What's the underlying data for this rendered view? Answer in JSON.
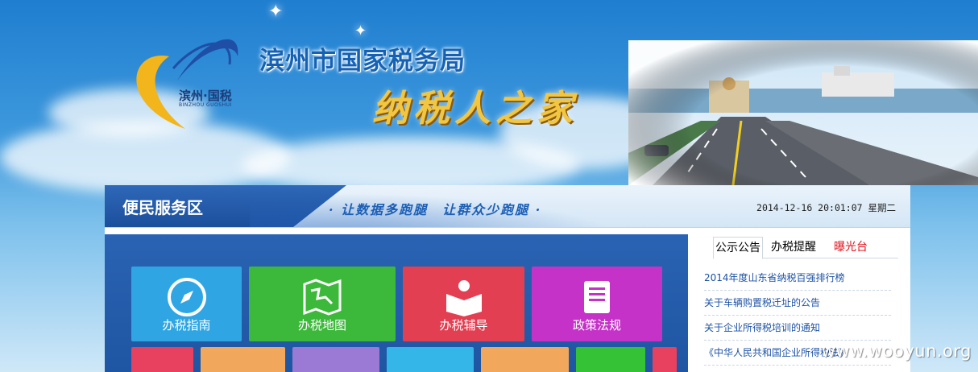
{
  "header": {
    "logo_text": "滨州·国税",
    "logo_subtext": "BINZHOU GUOSHUI",
    "org_title": "滨州市国家税务局",
    "slogan": "纳税人之家"
  },
  "service_panel": {
    "title": "便民服务区",
    "slogan": "· 让数据多跑腿　让群众少跑腿 ·",
    "datetime": "2014-12-16 20:01:07 星期二"
  },
  "tiles": [
    {
      "label": "办税指南",
      "icon": "compass-icon",
      "color": "#2fa6e3"
    },
    {
      "label": "办税地图",
      "icon": "map-icon",
      "color": "#3cb83a"
    },
    {
      "label": "办税辅导",
      "icon": "reading-icon",
      "color": "#e33f52"
    },
    {
      "label": "政策法规",
      "icon": "book-icon",
      "color": "#c532c8"
    }
  ],
  "tiles_row2_colors": [
    "#e8405f",
    "#f1a85c",
    "#9a7ad4",
    "#34b7e8",
    "#f1a85c",
    "#36c237",
    "#e8405f"
  ],
  "notices": {
    "tabs": [
      {
        "label": "公示公告",
        "active": true,
        "color": "#000000"
      },
      {
        "label": "办税提醒",
        "active": false,
        "color": "#000000"
      },
      {
        "label": "曝光台",
        "active": false,
        "color": "#e0101a"
      }
    ],
    "items": [
      "2014年度山东省纳税百强排行榜",
      "关于车辆购置税迁址的公告",
      "关于企业所得税培训的通知",
      "《中华人民共和国企业所得税法》"
    ]
  },
  "watermark": "www.wooyun.org"
}
